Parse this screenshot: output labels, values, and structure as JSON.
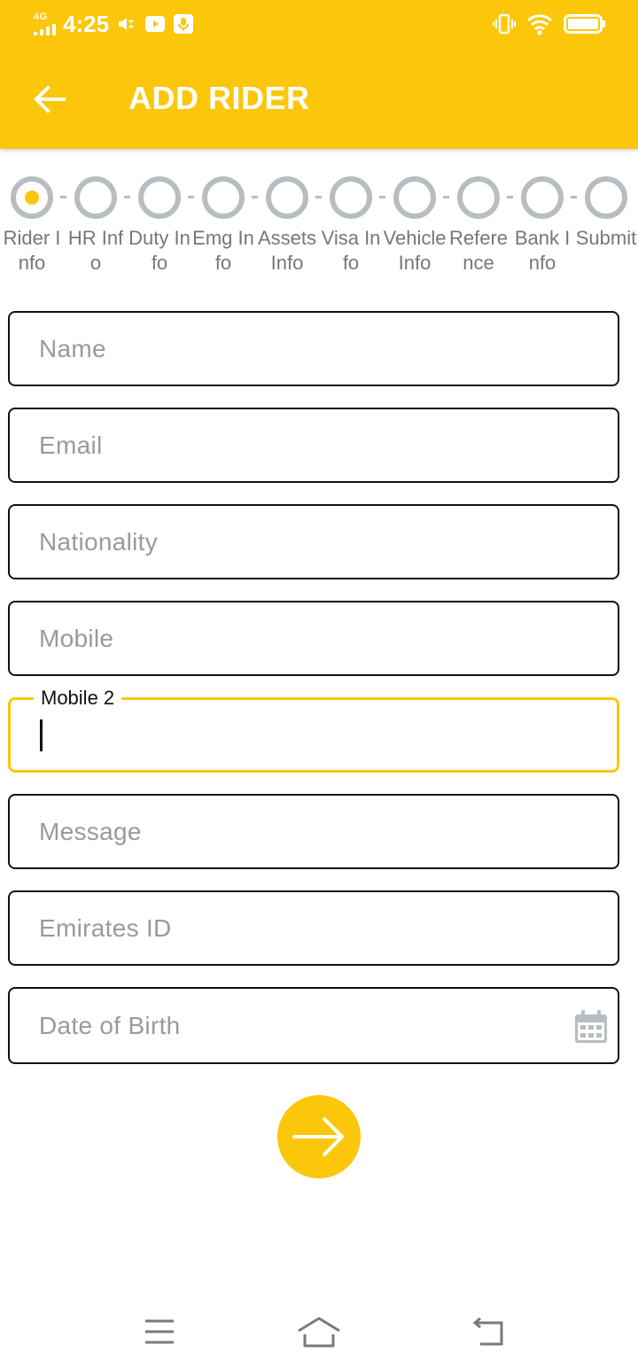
{
  "status_bar": {
    "network": "4G",
    "time": "4:25"
  },
  "toolbar": {
    "title": "ADD RIDER"
  },
  "steps": [
    {
      "label": "Rider Info",
      "active": true
    },
    {
      "label": "HR Info",
      "active": false
    },
    {
      "label": "Duty Info",
      "active": false
    },
    {
      "label": "Emg Info",
      "active": false
    },
    {
      "label": "Assets Info",
      "active": false
    },
    {
      "label": "Visa Info",
      "active": false
    },
    {
      "label": "Vehicle Info",
      "active": false
    },
    {
      "label": "Reference",
      "active": false
    },
    {
      "label": "Bank Info",
      "active": false
    },
    {
      "label": "Submit",
      "active": false
    }
  ],
  "form": {
    "name_placeholder": "Name",
    "email_placeholder": "Email",
    "nationality_placeholder": "Nationality",
    "mobile_placeholder": "Mobile",
    "mobile2_label": "Mobile 2",
    "mobile2_value": "",
    "message_placeholder": "Message",
    "emirates_id_placeholder": "Emirates ID",
    "dob_placeholder": "Date of Birth"
  },
  "colors": {
    "accent": "#FCC70A",
    "step_inactive": "#B7BDC0",
    "placeholder": "#9A9A9A",
    "border": "#111111"
  },
  "icons": {
    "back": "arrow-left-icon",
    "next": "arrow-right-icon",
    "calendar": "calendar-icon"
  }
}
